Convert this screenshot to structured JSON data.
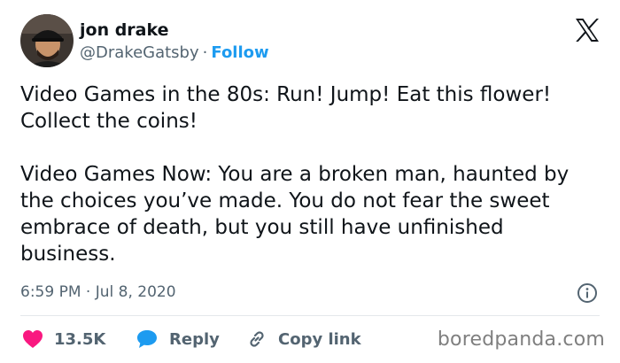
{
  "tweet": {
    "author": {
      "display_name": "jon drake",
      "handle": "@DrakeGatsby",
      "separator": "·",
      "follow_label": "Follow"
    },
    "platform_icon": "x-logo-icon",
    "paragraphs": [
      "Video Games in the 80s: Run! Jump! Eat this flower! Collect the coins!",
      "Video Games Now: You are a broken man, haunted by the choices you’ve made. You do not fear the sweet embrace of death, but you still have unfinished business."
    ],
    "timestamp": "6:59 PM · Jul 8, 2020",
    "actions": {
      "like_count": "13.5K",
      "reply_label": "Reply",
      "copy_link_label": "Copy link"
    }
  },
  "watermark": "boredpanda.com",
  "colors": {
    "text": "#0f1419",
    "muted": "#536471",
    "link_blue": "#1d9bf0",
    "like_pink": "#f91880",
    "divider": "#e4e8eb",
    "watermark": "#7f7f7f"
  },
  "icons": [
    "avatar",
    "x-logo-icon",
    "info-icon",
    "heart-icon",
    "reply-bubble-icon",
    "link-icon"
  ]
}
